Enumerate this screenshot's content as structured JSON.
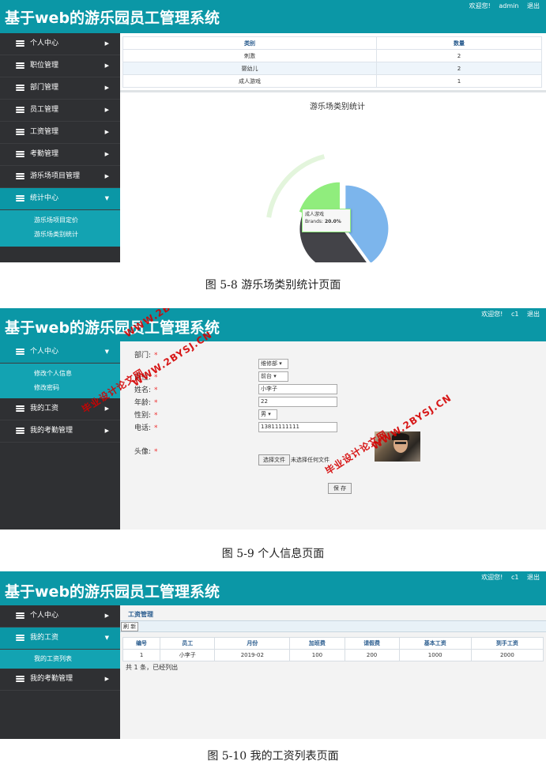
{
  "app_title": "基于web的游乐园员工管理系统",
  "s1": {
    "header_links": [
      "欢迎您!",
      "admin",
      "退出"
    ],
    "menu": [
      "个人中心",
      "职位管理",
      "部门管理",
      "员工管理",
      "工资管理",
      "考勤管理",
      "游乐场项目管理",
      "统计中心"
    ],
    "submenu": [
      "游乐场项目定价",
      "游乐场类别统计"
    ],
    "table": {
      "headers": [
        "类别",
        "数量"
      ],
      "rows": [
        [
          "刺激",
          "2"
        ],
        [
          "婴幼儿",
          "2"
        ],
        [
          "成人游戏",
          "1"
        ]
      ]
    },
    "chart_title": "游乐场类别统计",
    "tooltip": {
      "label": "成人游戏",
      "series": "Brands:",
      "value": "20.0%"
    },
    "caption": "图 5-8 游乐场类别统计页面"
  },
  "chart_data": {
    "type": "pie",
    "title": "游乐场类别统计",
    "series_name": "Brands",
    "labels": [
      "刺激",
      "婴幼儿",
      "成人游戏"
    ],
    "values": [
      40.0,
      40.0,
      20.0
    ],
    "colors": [
      "#7cb5ec",
      "#434348",
      "#90ed7d"
    ]
  },
  "s2": {
    "header_links": [
      "欢迎您!",
      "c1",
      "退出"
    ],
    "menu": [
      "个人中心",
      "我的工资",
      "我的考勤管理"
    ],
    "submenu": [
      "修改个人信息",
      "修改密码"
    ],
    "form": {
      "fields": [
        {
          "label": "部门:",
          "value": "维修部"
        },
        {
          "label": "岗位:",
          "value": "前台"
        },
        {
          "label": "姓名:",
          "value": "小李子"
        },
        {
          "label": "年龄:",
          "value": "22"
        },
        {
          "label": "性别:",
          "value": "男"
        },
        {
          "label": "电话:",
          "value": "13811111111"
        }
      ],
      "avatar_label": "头像:",
      "file_button": "选择文件",
      "file_status": "未选择任何文件",
      "save_button": "保 存"
    },
    "watermarks": [
      "毕业设计论文网",
      "WWW.2BYSJ.CN"
    ],
    "caption": "图 5-9 个人信息页面"
  },
  "s3": {
    "header_links": [
      "欢迎您!",
      "c1",
      "退出"
    ],
    "menu": [
      "个人中心",
      "我的工资",
      "我的考勤管理"
    ],
    "submenu": [
      "我的工资列表"
    ],
    "breadcrumb": "工资管理",
    "refresh": "刷 新",
    "table": {
      "headers": [
        "编号",
        "员工",
        "月份",
        "加班费",
        "请假费",
        "基本工资",
        "到手工资"
      ],
      "rows": [
        [
          "1",
          "小李子",
          "2019-02",
          "100",
          "200",
          "1000",
          "2000"
        ]
      ]
    },
    "summary": "共 1 条，已经列出",
    "caption": "图 5-10 我的工资列表页面"
  },
  "colors": {
    "accent": "#0b97a6",
    "sidebar": "#2f3033"
  }
}
